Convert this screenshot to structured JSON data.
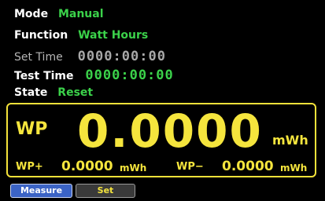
{
  "status": {
    "mode_label": "Mode",
    "mode_value": "Manual",
    "function_label": "Function",
    "function_value": "Watt Hours",
    "set_time_label": "Set Time",
    "set_time_value": "0000:00:00",
    "test_time_label": "Test Time",
    "test_time_value": "0000:00:00",
    "state_label": "State",
    "state_value": "Reset"
  },
  "readout": {
    "main_label": "WP",
    "main_value": "0.0000",
    "main_unit": "mWh",
    "plus_label": "WP+",
    "plus_value": "0.0000",
    "plus_unit": "mWh",
    "minus_label": "WP−",
    "minus_value": "0.0000",
    "minus_unit": "mWh"
  },
  "buttons": {
    "measure_label": "Measure",
    "set_label": "Set"
  },
  "colors": {
    "background": "#000000",
    "value_green": "#3bd24a",
    "readout_yellow": "#f5e53d",
    "measure_button": "#3b63c5",
    "set_button": "#3a3a3a"
  }
}
